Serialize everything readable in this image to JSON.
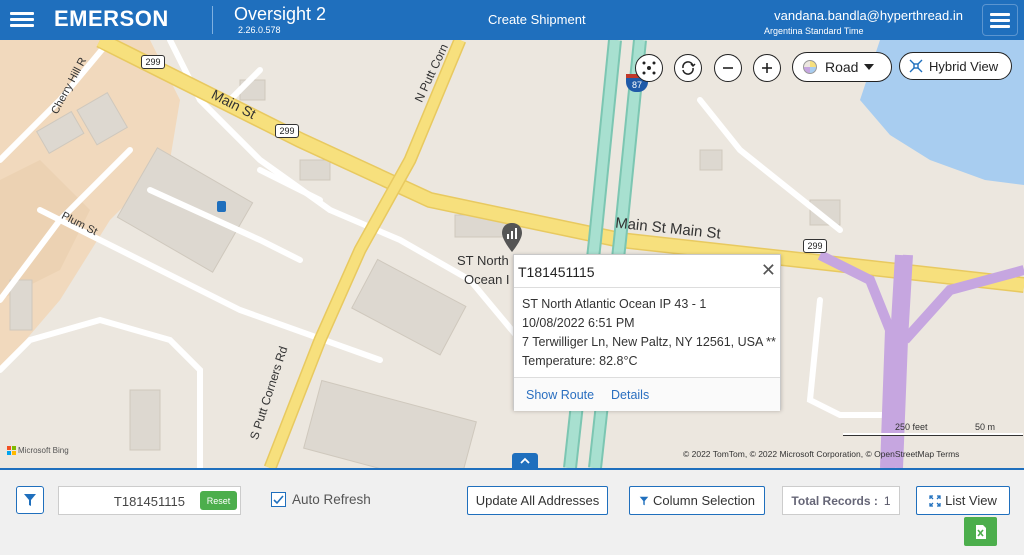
{
  "header": {
    "brand": "EMERSON",
    "brand_tm": ".",
    "app_name": "Oversight 2",
    "app_version": "2.26.0.578",
    "create_shipment": "Create Shipment",
    "user_email": "vandana.bandla@hyperthread.in",
    "user_timezone": "Argentina Standard Time"
  },
  "map": {
    "labels": {
      "main_st_west": "Main St",
      "main_st_east": "Main St  Main St",
      "plum_st": "Plum St",
      "cherry_hill": "Cherry Hill R",
      "n_putt_corners": "N Putt Corn",
      "s_putt_corners": "S Putt Corners Rd"
    },
    "shields": [
      "299",
      "299",
      "299",
      "299"
    ],
    "interstate": "87",
    "pin_label_line1": "ST North",
    "pin_label_line2": "Ocean I",
    "controls": {
      "road_label": "Road",
      "hybrid_label": "Hybrid View"
    },
    "popup": {
      "title": "T181451115",
      "line1": "ST North Atlantic Ocean IP 43 - 1",
      "line2": "10/08/2022 6:51 PM",
      "line3": "7 Terwilliger Ln, New Paltz, NY 12561, USA **",
      "line4": "Temperature: 82.8°C",
      "show_route": "Show Route",
      "details": "Details",
      "close": "✕"
    },
    "bing_text": "Microsoft Bing",
    "copyright": "© 2022 TomTom, © 2022 Microsoft Corporation, © OpenStreetMap   Terms",
    "scale_feet": "250 feet",
    "scale_m": "50 m"
  },
  "bottom": {
    "search_value": "T181451115",
    "reset_label": "Reset",
    "auto_refresh_label": "Auto Refresh",
    "auto_refresh_checked": true,
    "update_all_label": "Update All Addresses",
    "column_selection_label": "Column Selection",
    "total_records_label": "Total Records :",
    "total_records_value": "1",
    "list_view_label": "List View"
  },
  "colors": {
    "header_bg": "#1f6fbd",
    "accent_green": "#4cae4c",
    "highway_yellow": "#f7e07d",
    "interstate_teal": "#9fd8c8",
    "ramp_purple": "#c6a6e0",
    "water_blue": "#a8cdf0"
  }
}
